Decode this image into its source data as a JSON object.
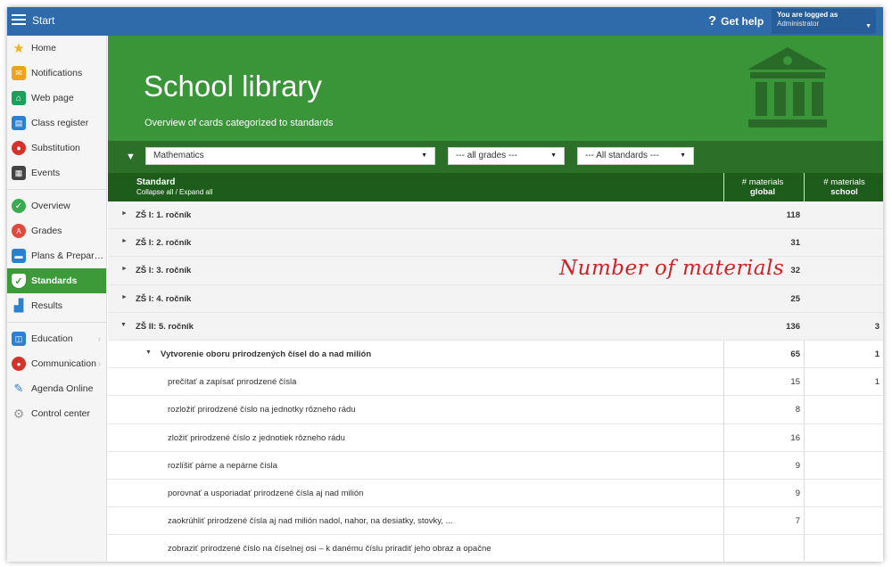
{
  "topbar": {
    "start_label": "Start",
    "help_label": "Get help",
    "help_mark": "?",
    "logged_as": "You are logged as",
    "user_name": "Administrator"
  },
  "sidebar": {
    "items": [
      {
        "label": "Home",
        "icon": "star-icon",
        "color": "#f2b21a"
      },
      {
        "label": "Notifications",
        "icon": "envelope-icon",
        "color": "#f0a21d"
      },
      {
        "label": "Web page",
        "icon": "house-icon",
        "color": "#1aa05a"
      },
      {
        "label": "Class register",
        "icon": "book-icon",
        "color": "#2b80d0"
      },
      {
        "label": "Substitution",
        "icon": "person-icon",
        "color": "#d6322c"
      },
      {
        "label": "Events",
        "icon": "calendar-icon",
        "color": "#444444"
      },
      {
        "label": "Overview",
        "icon": "check-circle-icon",
        "color": "#3aab4e"
      },
      {
        "label": "Grades",
        "icon": "grade-icon",
        "color": "#e04a3c"
      },
      {
        "label": "Plans & Prepar…",
        "icon": "briefcase-icon",
        "color": "#2b80d0"
      },
      {
        "label": "Standards",
        "icon": "shield-check-icon",
        "color": "#3d9a38"
      },
      {
        "label": "Results",
        "icon": "bar-chart-icon",
        "color": "#2b80d0"
      },
      {
        "label": "Education",
        "icon": "open-book-icon",
        "color": "#2b80d0"
      },
      {
        "label": "Communication",
        "icon": "chat-icon",
        "color": "#d6322c"
      },
      {
        "label": "Agenda Online",
        "icon": "pencil-icon",
        "color": "#2b80d0"
      },
      {
        "label": "Control center",
        "icon": "gear-icon",
        "color": "#999999"
      }
    ]
  },
  "hero": {
    "title": "School library",
    "subtitle": "Overview of cards categorized to standards"
  },
  "filters": {
    "subject": "Mathematics",
    "grades": "--- all grades ---",
    "standards": "--- All standards ---"
  },
  "table": {
    "col_standard": "Standard",
    "collapse_expand": "Collapse all / Expand all",
    "col_global_top": "# materials",
    "col_global_bottom": "global",
    "col_school_top": "# materials",
    "col_school_bottom": "school",
    "rows": [
      {
        "label": "ZŠ I: 1. ročník",
        "global": "118",
        "school": ""
      },
      {
        "label": "ZŠ I: 2. ročník",
        "global": "31",
        "school": ""
      },
      {
        "label": "ZŠ I: 3. ročník",
        "global": "32",
        "school": ""
      },
      {
        "label": "ZŠ I: 4. ročník",
        "global": "25",
        "school": ""
      },
      {
        "label": "ZŠ II: 5. ročník",
        "global": "136",
        "school": "3"
      },
      {
        "label": "Vytvorenie oboru prirodzených čísel do a nad milión",
        "global": "65",
        "school": "1"
      },
      {
        "label": "prečítať a zapísať prirodzené čísla",
        "global": "15",
        "school": "1"
      },
      {
        "label": "rozložiť prirodzené číslo na jednotky rôzneho rádu",
        "global": "8",
        "school": ""
      },
      {
        "label": "zložiť prirodzené číslo z jednotiek rôzneho rádu",
        "global": "16",
        "school": ""
      },
      {
        "label": "rozlíšiť párne a nepárne čísla",
        "global": "9",
        "school": ""
      },
      {
        "label": "porovnať a usporiadať prirodzené čísla aj nad milión",
        "global": "9",
        "school": ""
      },
      {
        "label": "zaokrúhliť prirodzené čísla aj nad milión nadol, nahor, na desiatky, stovky, ...",
        "global": "7",
        "school": ""
      },
      {
        "label": "zobraziť prirodzené číslo na číselnej osi – k danému číslu priradiť jeho obraz a opačne",
        "global": "",
        "school": ""
      }
    ]
  },
  "annotation": "Number of materials"
}
